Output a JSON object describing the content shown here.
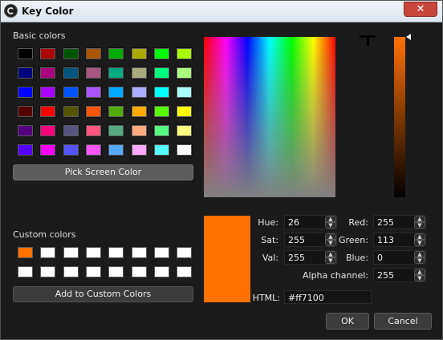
{
  "window": {
    "title": "Key Color",
    "close_label": "✕"
  },
  "basic": {
    "label": "Basic colors",
    "colors": [
      "#000000",
      "#aa0000",
      "#005500",
      "#aa5500",
      "#00aa00",
      "#aaaa00",
      "#00ff00",
      "#aaff00",
      "#00007f",
      "#aa007f",
      "#00557f",
      "#aa557f",
      "#00aa7f",
      "#aaaa7f",
      "#00ff7f",
      "#aaff7f",
      "#0000ff",
      "#aa00ff",
      "#0055ff",
      "#aa55ff",
      "#00aaff",
      "#aaaaff",
      "#00ffff",
      "#aaffff",
      "#550000",
      "#ff0000",
      "#555500",
      "#ff5500",
      "#55aa00",
      "#ffaa00",
      "#55ff00",
      "#ffff00",
      "#55007f",
      "#ff007f",
      "#55557f",
      "#ff557f",
      "#55aa7f",
      "#ffaa7f",
      "#55ff7f",
      "#ffff7f",
      "#5500ff",
      "#ff00ff",
      "#5555ff",
      "#ff55ff",
      "#55aaff",
      "#ffaaff",
      "#55ffff",
      "#ffffff"
    ]
  },
  "pick_screen_label": "Pick Screen Color",
  "custom": {
    "label": "Custom colors",
    "colors": [
      "#ff7100",
      "#ffffff",
      "#ffffff",
      "#ffffff",
      "#ffffff",
      "#ffffff",
      "#ffffff",
      "#ffffff",
      "#ffffff",
      "#ffffff",
      "#ffffff",
      "#ffffff",
      "#ffffff",
      "#ffffff",
      "#ffffff",
      "#ffffff"
    ]
  },
  "add_custom_label": "Add to Custom Colors",
  "current_color": "#ff7100",
  "fields": {
    "hue_label": "Hue:",
    "hue": "26",
    "sat_label": "Sat:",
    "sat": "255",
    "val_label": "Val:",
    "val": "255",
    "red_label": "Red:",
    "red": "255",
    "green_label": "Green:",
    "green": "113",
    "blue_label": "Blue:",
    "blue": "0",
    "alpha_label": "Alpha channel:",
    "alpha": "255",
    "html_label": "HTML:",
    "html": "#ff7100"
  },
  "buttons": {
    "ok": "OK",
    "cancel": "Cancel"
  }
}
